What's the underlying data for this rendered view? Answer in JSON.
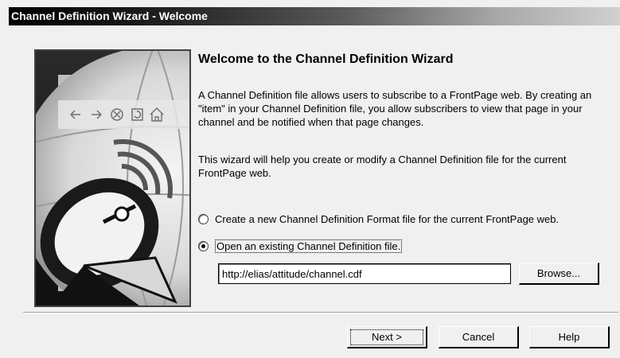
{
  "window": {
    "title": "Channel Definition Wizard - Welcome"
  },
  "content": {
    "heading": "Welcome to the Channel Definition Wizard",
    "paragraph1": "A Channel Definition file allows users to subscribe to a FrontPage web.  By creating an \"item\" in your Channel Definition file, you allow subscribers to view that page in your channel and be notified when that page changes.",
    "paragraph2": "This wizard will help you create or modify a Channel Definition file for the current FrontPage web."
  },
  "options": {
    "create_new_label": "Create a new Channel Definition Format file for the current FrontPage web.",
    "open_existing_label": "Open an existing Channel Definition file.",
    "selected": "open_existing"
  },
  "url_field": {
    "value": "http://elias/attitude/channel.cdf"
  },
  "buttons": {
    "browse_label": "Browse...",
    "next_label": "Next >",
    "cancel_label": "Cancel",
    "help_label": "Help"
  },
  "icons": [
    "back-arrow-icon",
    "forward-arrow-icon",
    "stop-icon",
    "refresh-icon",
    "home-icon",
    "satellite-dish-icon",
    "globe-icon"
  ]
}
